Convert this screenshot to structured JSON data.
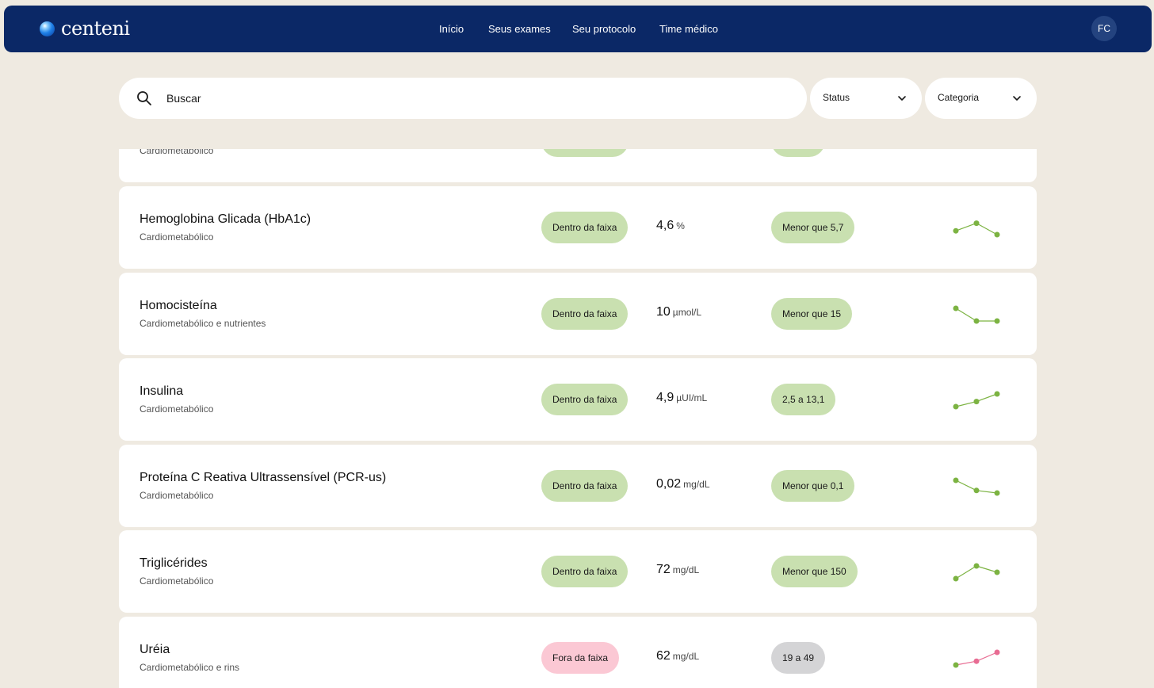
{
  "header": {
    "brand": "centeni",
    "nav": [
      "Início",
      "Seus exames",
      "Seu protocolo",
      "Time médico"
    ],
    "avatar_initials": "FC"
  },
  "search": {
    "placeholder": "Buscar"
  },
  "filters": {
    "status_label": "Status",
    "category_label": "Categoria"
  },
  "colors": {
    "in_range": "#c9e0b0",
    "out_of_range": "#fbc8d4",
    "neutral": "#d4d4d6",
    "spark_green": "#7cb342",
    "spark_pink": "#e86c93"
  },
  "partial_row": {
    "category": "Cardiometabólico"
  },
  "exams": [
    {
      "name": "Hemoglobina Glicada (HbA1c)",
      "category": "Cardiometabólico",
      "status": "Dentro da faixa",
      "value": "4,6",
      "unit": "%",
      "range": "Menor que 5,7",
      "range_style": "green",
      "status_style": "green",
      "trend": [
        0.3,
        0.9,
        0.0
      ],
      "trend_colors": [
        "green",
        "green",
        "green"
      ]
    },
    {
      "name": "Homocisteína",
      "category": "Cardiometabólico e nutrientes",
      "status": "Dentro da faixa",
      "value": "10",
      "unit": "µmol/L",
      "range": "Menor que 15",
      "range_style": "green",
      "status_style": "green",
      "trend": [
        1.0,
        0.0,
        0.0
      ],
      "trend_colors": [
        "green",
        "green",
        "green"
      ]
    },
    {
      "name": "Insulina",
      "category": "Cardiometabólico",
      "status": "Dentro da faixa",
      "value": "4,9",
      "unit": "µUI/mL",
      "range": "2,5 a 13,1",
      "range_style": "green",
      "status_style": "green",
      "trend": [
        0.0,
        0.4,
        1.0
      ],
      "trend_colors": [
        "green",
        "green",
        "green"
      ]
    },
    {
      "name": "Proteína C Reativa Ultrassensível (PCR-us)",
      "category": "Cardiometabólico",
      "status": "Dentro da faixa",
      "value": "0,02",
      "unit": "mg/dL",
      "range": "Menor que 0,1",
      "range_style": "green",
      "status_style": "green",
      "trend": [
        1.0,
        0.2,
        0.0
      ],
      "trend_colors": [
        "green",
        "green",
        "green"
      ]
    },
    {
      "name": "Triglicérides",
      "category": "Cardiometabólico",
      "status": "Dentro da faixa",
      "value": "72",
      "unit": "mg/dL",
      "range": "Menor que 150",
      "range_style": "green",
      "status_style": "green",
      "trend": [
        0.0,
        1.0,
        0.5
      ],
      "trend_colors": [
        "green",
        "green",
        "green"
      ]
    },
    {
      "name": "Uréia",
      "category": "Cardiometabólico e rins",
      "status": "Fora da faixa",
      "value": "62",
      "unit": "mg/dL",
      "range": "19 a 49",
      "range_style": "grey",
      "status_style": "pink",
      "trend": [
        0.0,
        0.3,
        1.0
      ],
      "trend_colors": [
        "green",
        "pink",
        "pink"
      ]
    }
  ]
}
